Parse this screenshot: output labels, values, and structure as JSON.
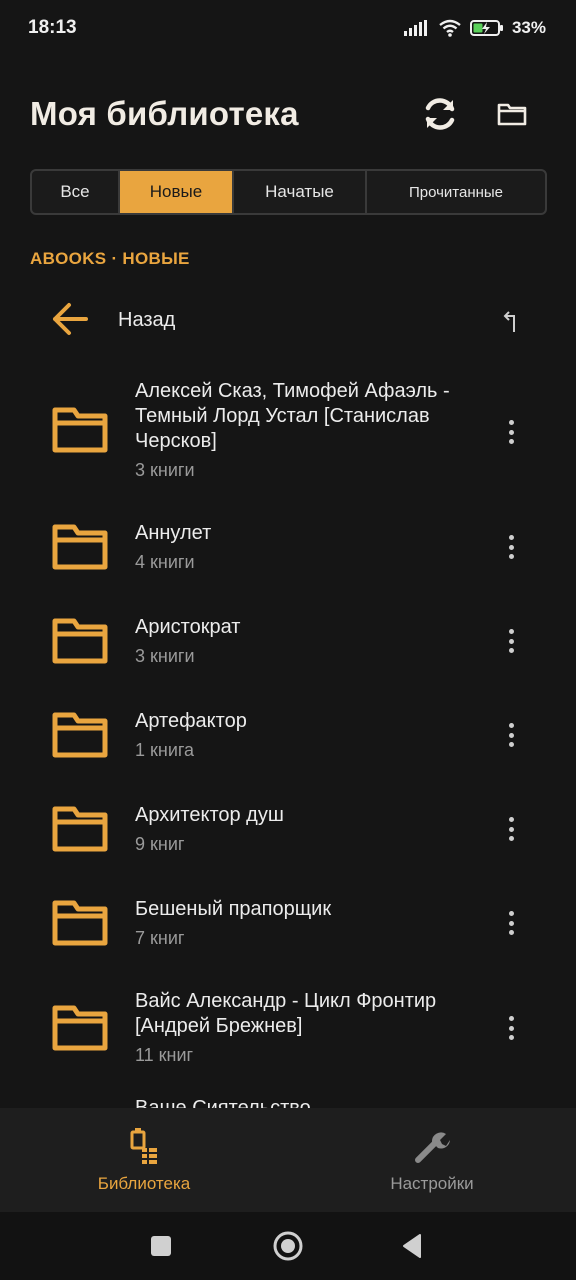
{
  "status_bar": {
    "time": "18:13",
    "battery_percent": "33%",
    "icons": [
      "signal-icon",
      "wifi-icon",
      "battery-charging-icon"
    ]
  },
  "header": {
    "title": "Моя библиотека",
    "icons": [
      "refresh-icon",
      "folder-icon"
    ]
  },
  "tabs": [
    {
      "label": "Все",
      "active": false
    },
    {
      "label": "Новые",
      "active": true
    },
    {
      "label": "Начатые",
      "active": false
    },
    {
      "label": "Прочитанные",
      "active": false
    }
  ],
  "breadcrumb": "ABOOKS · НОВЫЕ",
  "back_row": {
    "label": "Назад",
    "icons": [
      "arrow-left-icon",
      "up-level-icon"
    ]
  },
  "items": [
    {
      "title": "Алексей Сказ, Тимофей Афаэль - Темный Лорд Устал [Станислав Черсков]",
      "subtitle": "3 книги"
    },
    {
      "title": "Аннулет",
      "subtitle": "4 книги"
    },
    {
      "title": "Аристократ",
      "subtitle": "3 книги"
    },
    {
      "title": "Артефактор",
      "subtitle": "1 книга"
    },
    {
      "title": "Архитектор душ",
      "subtitle": "9 книг"
    },
    {
      "title": "Бешеный прапорщик",
      "subtitle": "7 книг"
    },
    {
      "title": "Вайс Александр - Цикл Фронтир [Андрей Брежнев]",
      "subtitle": "11 книг"
    },
    {
      "title": "Ваше Сиятельство",
      "subtitle": ""
    }
  ],
  "bottom_nav": [
    {
      "label": "Библиотека",
      "icon": "library-icon",
      "active": true
    },
    {
      "label": "Настройки",
      "icon": "wrench-icon",
      "active": false
    }
  ],
  "system_nav": [
    "recents-icon",
    "home-icon",
    "back-icon"
  ],
  "colors": {
    "accent": "#e9a53f",
    "background": "#151515",
    "nav_background": "#1e1e1e",
    "secondary_text": "#9a9a9a"
  }
}
